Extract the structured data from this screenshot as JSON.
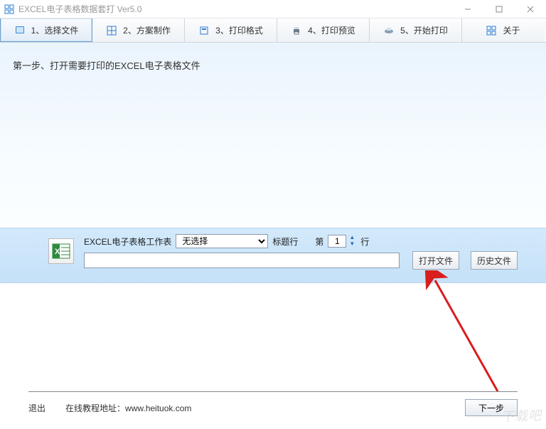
{
  "window": {
    "title": "EXCEL电子表格数据套打 Ver5.0"
  },
  "tabs": {
    "t1": "1、选择文件",
    "t2": "2、方案制作",
    "t3": "3、打印格式",
    "t4": "4、打印预览",
    "t5": "5、开始打印",
    "about": "关于"
  },
  "main": {
    "instruction": "第一步、打开需要打印的EXCEL电子表格文件",
    "worksheet_label": "EXCEL电子表格工作表",
    "select_value": "无选择",
    "header_row_label": "标题行",
    "row_prefix": "第",
    "row_value": "1",
    "row_suffix": "行",
    "path_value": "",
    "open_button": "打开文件",
    "history_button": "历史文件"
  },
  "footer": {
    "exit": "退出",
    "tutorial_label": "在线教程地址：",
    "tutorial_url": "www.heituok.com",
    "next": "下一步"
  },
  "watermark": "下载吧"
}
